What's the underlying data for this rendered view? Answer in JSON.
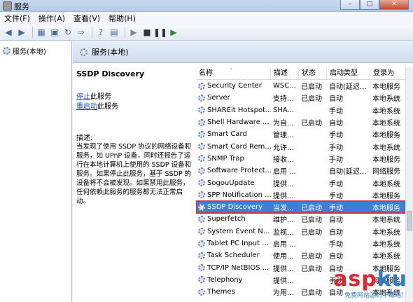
{
  "window": {
    "title": "服务"
  },
  "menu": [
    "文件(F)",
    "操作(A)",
    "查看(V)",
    "帮助(H)"
  ],
  "toolbar": {
    "icons": [
      "back-icon",
      "forward-icon",
      "console-icon",
      "properties-icon",
      "refresh-icon",
      "export-icon",
      "help-icon",
      "view-icon",
      "play-icon",
      "stop-icon",
      "pause-icon",
      "restart-icon"
    ]
  },
  "tree": {
    "item": "服务(本地)"
  },
  "header": {
    "title": "服务(本地)"
  },
  "details": {
    "service_name": "SSDP Discovery",
    "stop_link": "停止",
    "stop_suffix": "此服务",
    "restart_link": "重启动",
    "restart_suffix": "此服务",
    "desc_label": "描述:",
    "desc_text": "当发现了使用 SSDP 协议的网络设备和服务，如 UPnP 设备，同时还报告了运行在本地计算机上使用的 SSDP 设备和服务。如果停止此服务，基于 SSDP 的设备将不会被发现。如果禁用此服务，任何依赖此服务的服务都无法正常启动。"
  },
  "table": {
    "columns": [
      "名称",
      "描述",
      "状态",
      "启动类型",
      "登录为"
    ],
    "rows": [
      [
        "Security Center",
        "WSC...",
        "已启动",
        "自动(延迟...",
        "本地服务"
      ],
      [
        "Server",
        "支持...",
        "已启动",
        "自动",
        "本地系统"
      ],
      [
        "SHAREit Hotspot...",
        "SHA...",
        "",
        "手动",
        "本地系统"
      ],
      [
        "Shell Hardware ...",
        "为自...",
        "已启动",
        "自动",
        "本地系统"
      ],
      [
        "Smart Card",
        "管理...",
        "",
        "手动",
        "本地服务"
      ],
      [
        "Smart Card Rem...",
        "允许...",
        "",
        "手动",
        "本地系统"
      ],
      [
        "SNMP Trap",
        "接收...",
        "",
        "手动",
        "本地服务"
      ],
      [
        "Software Protect...",
        "启用 ...",
        "",
        "自动(延迟...",
        "网络服务"
      ],
      [
        "SogouUpdate",
        "提供...",
        "",
        "手动",
        "本地系统"
      ],
      [
        "SPP Notification ...",
        "提供...",
        "",
        "手动",
        "本地服务"
      ],
      [
        "SSDP Discovery",
        "当发...",
        "已启动",
        "手动",
        "本地服务"
      ],
      [
        "Superfetch",
        "维护...",
        "已启动",
        "自动",
        "本地系统"
      ],
      [
        "System Event N...",
        "监视...",
        "已启动",
        "自动",
        "本地系统"
      ],
      [
        "Tablet PC Input ...",
        "启用 ...",
        "",
        "手动",
        "本地系统"
      ],
      [
        "Task Scheduler",
        "使用...",
        "已启动",
        "自动",
        "本地系统"
      ],
      [
        "TCP/IP NetBIOS ...",
        "提供...",
        "已启动",
        "自动",
        "本地服务"
      ],
      [
        "Telephony",
        "提供...",
        "",
        "手动",
        "网络服务"
      ],
      [
        "Themes",
        "为用...",
        "已启动",
        "自动",
        "本地系统"
      ]
    ],
    "selected_index": 10
  },
  "watermark": {
    "brand_a": "asp",
    "brand_b": "ku",
    "sub": "免费网站源码下载站！"
  }
}
